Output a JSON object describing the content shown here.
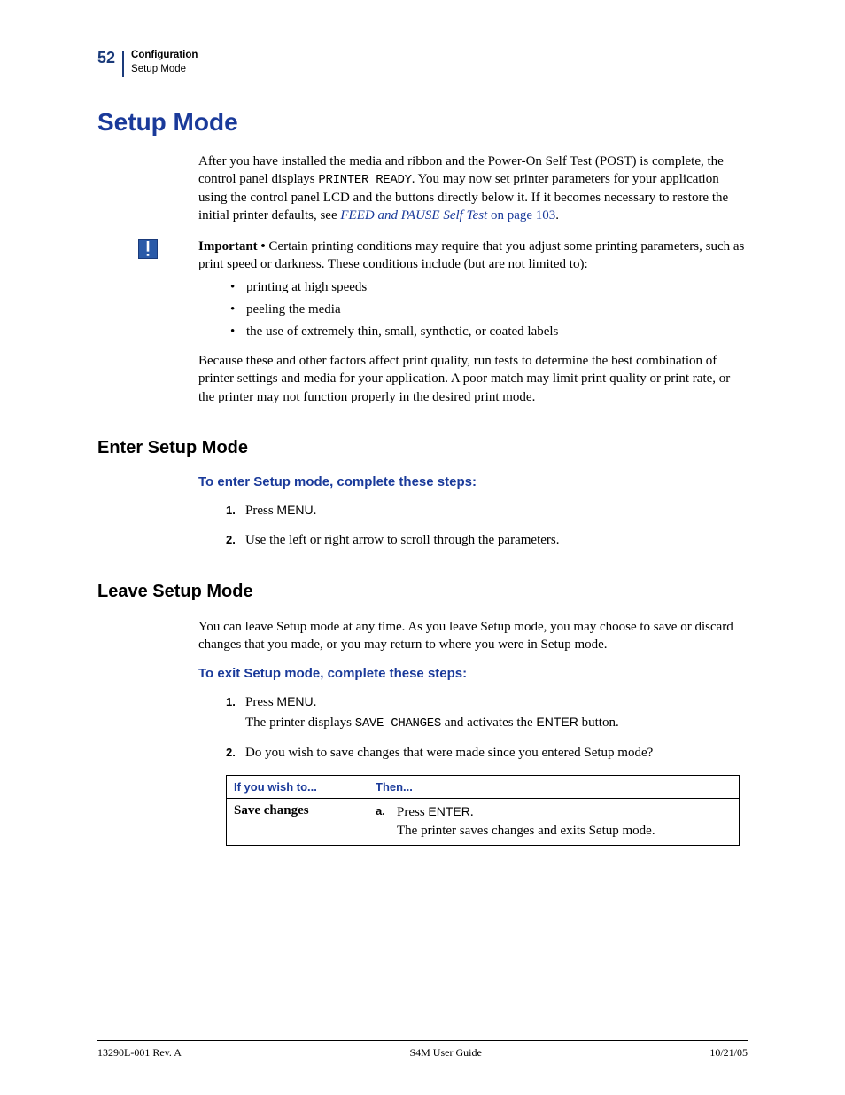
{
  "header": {
    "page_number": "52",
    "chapter": "Configuration",
    "section": "Setup Mode"
  },
  "title": "Setup Mode",
  "intro": {
    "part1": "After you have installed the media and ribbon and the Power-On Self Test (POST) is complete, the control panel displays ",
    "lcd_text": "PRINTER READY",
    "part2": ". You may now set printer parameters for your application using the control panel LCD and the buttons directly below it. If it becomes necessary to restore the initial printer defaults, see ",
    "xref_italic": "FEED and PAUSE Self Test ",
    "xref_plain": "on page 103",
    "part3": "."
  },
  "note": {
    "label": "Important • ",
    "text": "Certain printing conditions may require that you adjust some printing parameters, such as print speed or darkness. These conditions include (but are not limited to):"
  },
  "bullets": [
    "printing at high speeds",
    "peeling the media",
    "the use of extremely thin, small, synthetic, or coated labels"
  ],
  "after_bullets": "Because these and other factors affect print quality, run tests to determine the best combination of printer settings and media for your application. A poor match may limit print quality or print rate, or the printer may not function properly in the desired print mode.",
  "enter": {
    "heading": "Enter Setup Mode",
    "step_title": "To enter Setup mode, complete these steps:",
    "steps": [
      {
        "pre": "Press ",
        "ui": "MENU",
        "post": "."
      },
      {
        "pre": "Use the left or right arrow to scroll through the parameters.",
        "ui": "",
        "post": ""
      }
    ]
  },
  "leave": {
    "heading": "Leave Setup Mode",
    "intro": "You can leave Setup mode at any time. As you leave Setup mode, you may choose to save or discard changes that you made, or you may return to where you were in Setup mode.",
    "step_title": "To exit Setup mode, complete these steps:",
    "step1_pre": "Press ",
    "step1_ui": "MENU",
    "step1_post": ".",
    "step1b_pre": "The printer displays ",
    "step1b_lcd": "SAVE CHANGES",
    "step1b_mid": " and activates the ",
    "step1b_ui": "ENTER",
    "step1b_post": " button.",
    "step2": "Do you wish to save changes that were made since you entered Setup mode?"
  },
  "table": {
    "th1": "If you wish to...",
    "th2": "Then...",
    "row1_col1": "Save changes",
    "row1_marker": "a.",
    "row1_line1_pre": "Press ",
    "row1_line1_ui": "ENTER",
    "row1_line1_post": ".",
    "row1_line2": "The printer saves changes and exits Setup mode."
  },
  "footer": {
    "left": "13290L-001 Rev. A",
    "center": "S4M User Guide",
    "right": "10/21/05"
  }
}
